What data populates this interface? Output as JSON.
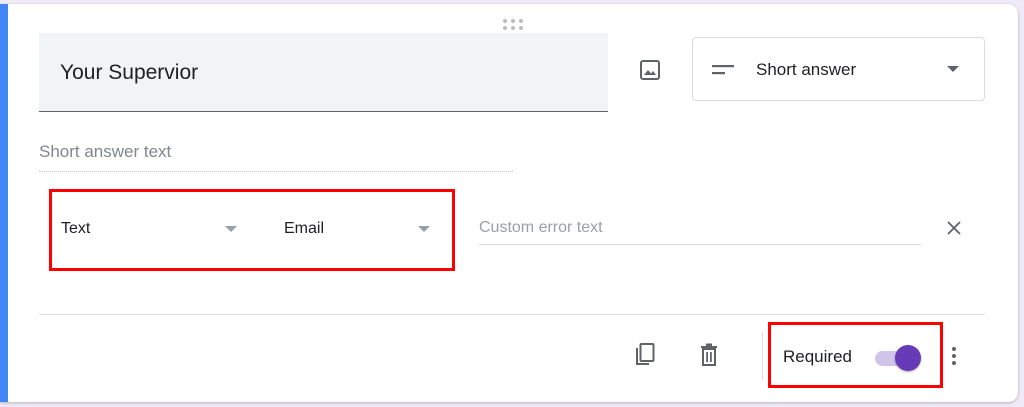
{
  "question": {
    "title": "Your Supervior",
    "type_label": "Short answer",
    "answer_hint": "Short answer text"
  },
  "validation": {
    "rule_type": "Text",
    "rule_condition": "Email",
    "custom_error_placeholder": "Custom error text",
    "custom_error_value": ""
  },
  "footer": {
    "required_label": "Required",
    "required_on": true
  },
  "icons": {
    "drag": "drag-handle-icon",
    "image": "image-icon",
    "type": "short-answer-icon",
    "close": "close-icon",
    "copy": "copy-icon",
    "delete": "delete-icon",
    "more": "more-vert-icon"
  },
  "colors": {
    "accent": "#4285f4",
    "toggle_on": "#673ab7",
    "highlight": "#ff0000"
  }
}
